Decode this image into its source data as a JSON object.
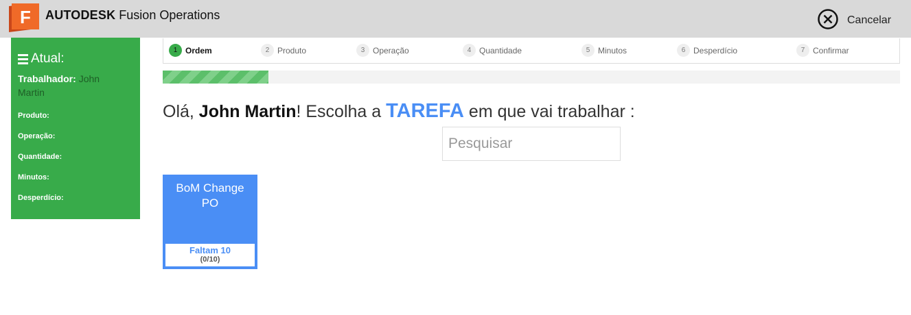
{
  "header": {
    "logo_letter": "F",
    "brand_bold": "AUTODESK",
    "brand_rest": "Fusion Operations",
    "cancel_label": "Cancelar",
    "logo_color": "#f06a28"
  },
  "sidebar": {
    "heading": "Atual:",
    "worker_label": "Trabalhador:",
    "worker_value": "John Martin",
    "fields": [
      "Produto:",
      "Operação:",
      "Quantidade:",
      "Minutos:",
      "Desperdício:"
    ],
    "background": "#38ab4a"
  },
  "steps": [
    {
      "num": "1",
      "label": "Ordem"
    },
    {
      "num": "2",
      "label": "Produto"
    },
    {
      "num": "3",
      "label": "Operação"
    },
    {
      "num": "4",
      "label": "Quantidade"
    },
    {
      "num": "5",
      "label": "Minutos"
    },
    {
      "num": "6",
      "label": "Desperdício"
    },
    {
      "num": "7",
      "label": "Confirmar"
    }
  ],
  "active_step": "Ordem",
  "progress": 0.143,
  "headline": {
    "greeting": "Olá, ",
    "name": "John Martin",
    "middle": "! Escolha a ",
    "task": "TAREFA",
    "end": " em que vai trabalhar :"
  },
  "search": {
    "placeholder": "Pesquisar",
    "value": ""
  },
  "tasks": [
    {
      "title": "BoM Change PO",
      "remaining": "Faltam 10",
      "count": "(0/10)"
    }
  ],
  "accent_color": "#4a8ef5"
}
